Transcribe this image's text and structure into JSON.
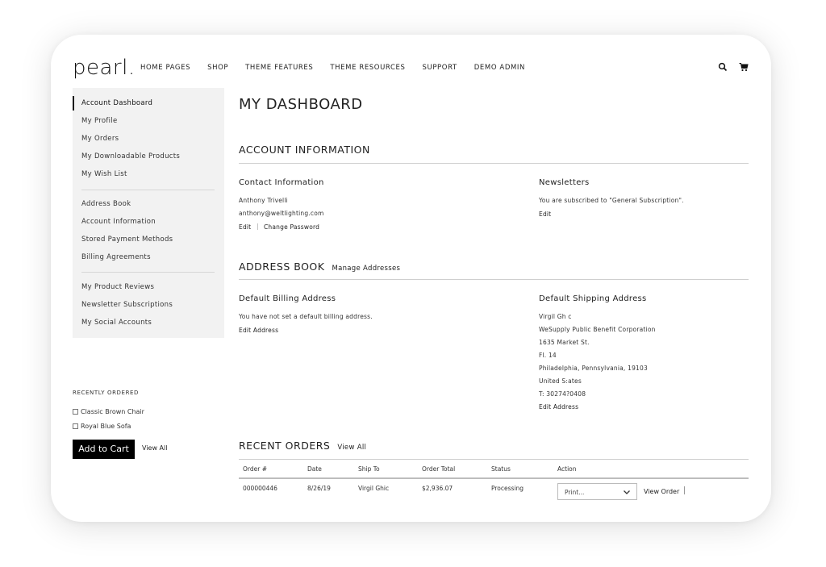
{
  "header": {
    "logo": "pearl.",
    "nav": [
      "HOME PAGES",
      "SHOP",
      "THEME FEATURES",
      "THEME RESOURCES",
      "SUPPORT",
      "DEMO ADMIN"
    ],
    "icons": [
      "search-icon",
      "cart-icon"
    ]
  },
  "sidebar": {
    "group1": [
      "Account Dashboard",
      "My Profile",
      "My Orders",
      "My Downloadable Products",
      "My Wish List"
    ],
    "group2": [
      "Address Book",
      "Account Information",
      "Stored Payment Methods",
      "Billing Agreements"
    ],
    "group3": [
      "My Product Reviews",
      "Newsletter Subscriptions",
      "My Social Accounts"
    ]
  },
  "recent": {
    "title": "RECENTLY ORDERED",
    "items": [
      "Classic Brown Chair",
      "Royal Blue Sofa"
    ],
    "add_to_cart": "Add to Cart",
    "view_all": "View All"
  },
  "main": {
    "title": "MY DASHBOARD",
    "account_info": {
      "title": "ACCOUNT INFORMATION",
      "contact": {
        "title": "Contact Information",
        "name": "Anthony Trivelli",
        "email": "anthony@weltlighting.com",
        "edit": "Edit",
        "sep": "|",
        "change_password": "Change Password"
      },
      "newsletters": {
        "title": "Newsletters",
        "text": "You are subscribed to \"General Subscription\".",
        "edit": "Edit"
      }
    },
    "address_book": {
      "title": "ADDRESS BOOK",
      "manage": "Manage Addresses",
      "billing": {
        "title": "Default Billing Address",
        "text": "You have not set a default billing address.",
        "edit": "Edit Address"
      },
      "shipping": {
        "title": "Default Shipping Address",
        "lines": [
          "Virgil Gh c",
          "WeSupply Public Benefit Corporation",
          "1635 Market St.",
          "Fl. 14",
          "Philadelphia, Pennsylvania, 19103",
          "United S:ates",
          "T: 30274?0408"
        ],
        "edit": "Edit Address"
      }
    },
    "recent_orders": {
      "title": "RECENT ORDERS",
      "view_all": "View All",
      "columns": [
        "Order #",
        "Date",
        "Ship To",
        "Order Total",
        "Status",
        "Action"
      ],
      "rows": [
        {
          "order": "000000446",
          "date": "8/26/19",
          "ship_to": "Virgil Ghic",
          "total": "$2,936.07",
          "status": "Processing",
          "print": "Print...",
          "view_order": "View Order"
        }
      ]
    }
  }
}
